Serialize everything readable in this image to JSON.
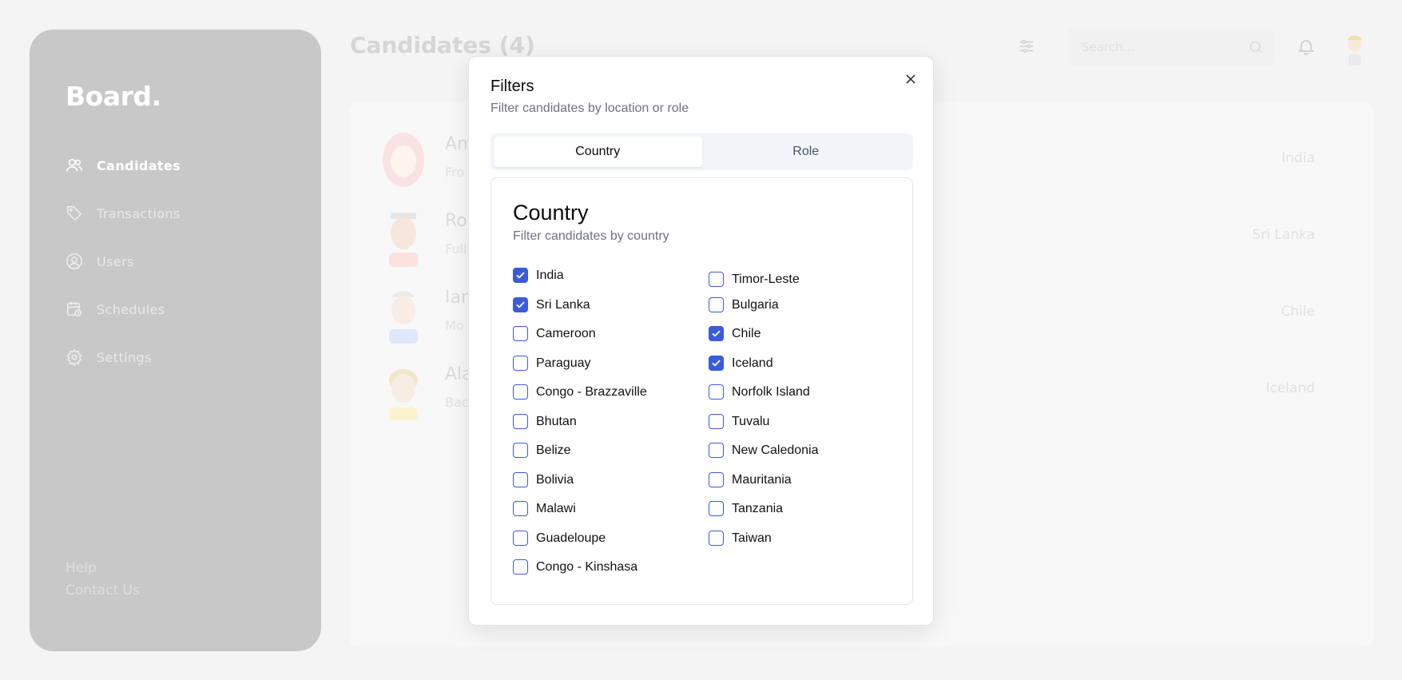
{
  "sidebar": {
    "brand": "Board.",
    "items": [
      {
        "label": "Candidates",
        "icon": "users-icon",
        "active": true
      },
      {
        "label": "Transactions",
        "icon": "tag-icon",
        "active": false
      },
      {
        "label": "Users",
        "icon": "user-circle-icon",
        "active": false
      },
      {
        "label": "Schedules",
        "icon": "calendar-clock-icon",
        "active": false
      },
      {
        "label": "Settings",
        "icon": "gear-icon",
        "active": false
      }
    ],
    "footer": {
      "help": "Help",
      "contact": "Contact Us"
    }
  },
  "header": {
    "title": "Candidates (4)",
    "search_placeholder": "Search..."
  },
  "candidates": [
    {
      "name": "Am",
      "subtitle": "Fro",
      "location": "India"
    },
    {
      "name": "Ro",
      "subtitle": "Full",
      "location": "Sri Lanka"
    },
    {
      "name": "Ian",
      "subtitle": "Mo",
      "location": "Chile"
    },
    {
      "name": "Ala",
      "subtitle": "Bac",
      "location": "Iceland"
    }
  ],
  "modal": {
    "title": "Filters",
    "description": "Filter candidates by location or role",
    "tabs": [
      {
        "label": "Country",
        "active": true
      },
      {
        "label": "Role",
        "active": false
      }
    ],
    "panel": {
      "title": "Country",
      "description": "Filter candidates by country",
      "left_column": [
        {
          "label": "India",
          "checked": true
        },
        {
          "label": "Sri Lanka",
          "checked": true
        },
        {
          "label": "Cameroon",
          "checked": false
        },
        {
          "label": "Paraguay",
          "checked": false
        },
        {
          "label": "Congo - Brazzaville",
          "checked": false
        },
        {
          "label": "Bhutan",
          "checked": false
        },
        {
          "label": "Belize",
          "checked": false
        },
        {
          "label": "Bolivia",
          "checked": false
        },
        {
          "label": "Malawi",
          "checked": false
        },
        {
          "label": "Guadeloupe",
          "checked": false
        },
        {
          "label": "Congo - Kinshasa",
          "checked": false
        }
      ],
      "right_column": [
        {
          "label": "Timor-Leste",
          "checked": false
        },
        {
          "label": "Bulgaria",
          "checked": false
        },
        {
          "label": "Chile",
          "checked": true
        },
        {
          "label": "Iceland",
          "checked": true
        },
        {
          "label": "Norfolk Island",
          "checked": false
        },
        {
          "label": "Tuvalu",
          "checked": false
        },
        {
          "label": "New Caledonia",
          "checked": false
        },
        {
          "label": "Mauritania",
          "checked": false
        },
        {
          "label": "Tanzania",
          "checked": false
        },
        {
          "label": "Taiwan",
          "checked": false
        }
      ]
    }
  },
  "colors": {
    "accent": "#3b5bdb",
    "sidebar_bg": "#c8c8c8"
  }
}
